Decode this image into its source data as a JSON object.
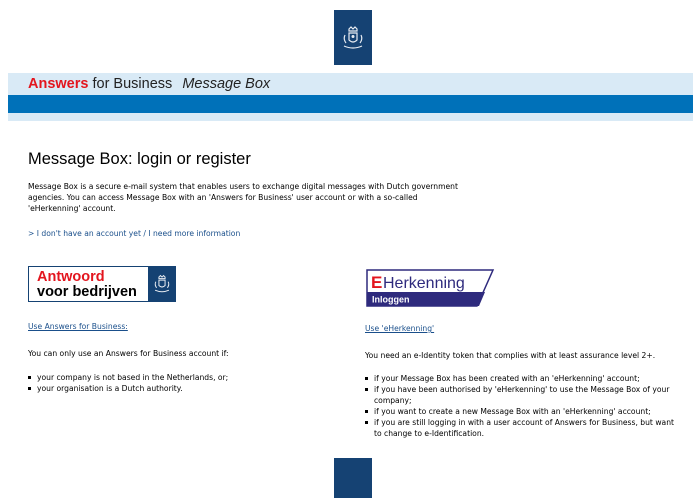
{
  "brand": {
    "answers": "Answers",
    "for_business": "for Business",
    "message_box": "Message Box"
  },
  "page": {
    "title": "Message Box: login or register",
    "intro": "Message Box is a secure e-mail system that enables users to exchange digital messages with Dutch government agencies. You can access Message Box with an 'Answers for Business' user account or with a so-called 'eHerkenning' account.",
    "more_info_link": "> I don't have an account yet / I need more information"
  },
  "left_column": {
    "logo_line1": "Antwoord",
    "logo_line2": "voor bedrijven",
    "link": "Use Answers for Business:",
    "lead": "You can only use an Answers for Business account if:",
    "bullets": [
      "your company is not based in the Netherlands, or;",
      "your organisation is a Dutch authority."
    ]
  },
  "right_column": {
    "logo_e": "E",
    "logo_name": "Herkenning",
    "logo_sub": "Inloggen",
    "link": "Use 'eHerkenning'",
    "lead": "You need an e-Identity token that complies with at least assurance level 2+.",
    "bullets": [
      "if your Message Box has been created with an 'eHerkenning' account;",
      "if you have been authorised by 'eHerkenning' to use the Message Box of your company;",
      "if you want to create a new Message Box with an 'eHerkenning' account;",
      "if you are still logging in with a user account of Answers for Business, but want to change to e-Identification."
    ]
  },
  "colors": {
    "brand_red": "#e3151e",
    "bar_blue": "#0071b9",
    "pale_blue": "#d9eaf6",
    "emblem_navy": "#154273",
    "link_blue": "#1a4f8b",
    "eh_purple": "#2e2a7d"
  },
  "icons": {
    "top_emblem": "coat-of-arms-icon",
    "afb_emblem": "coat-of-arms-icon"
  }
}
